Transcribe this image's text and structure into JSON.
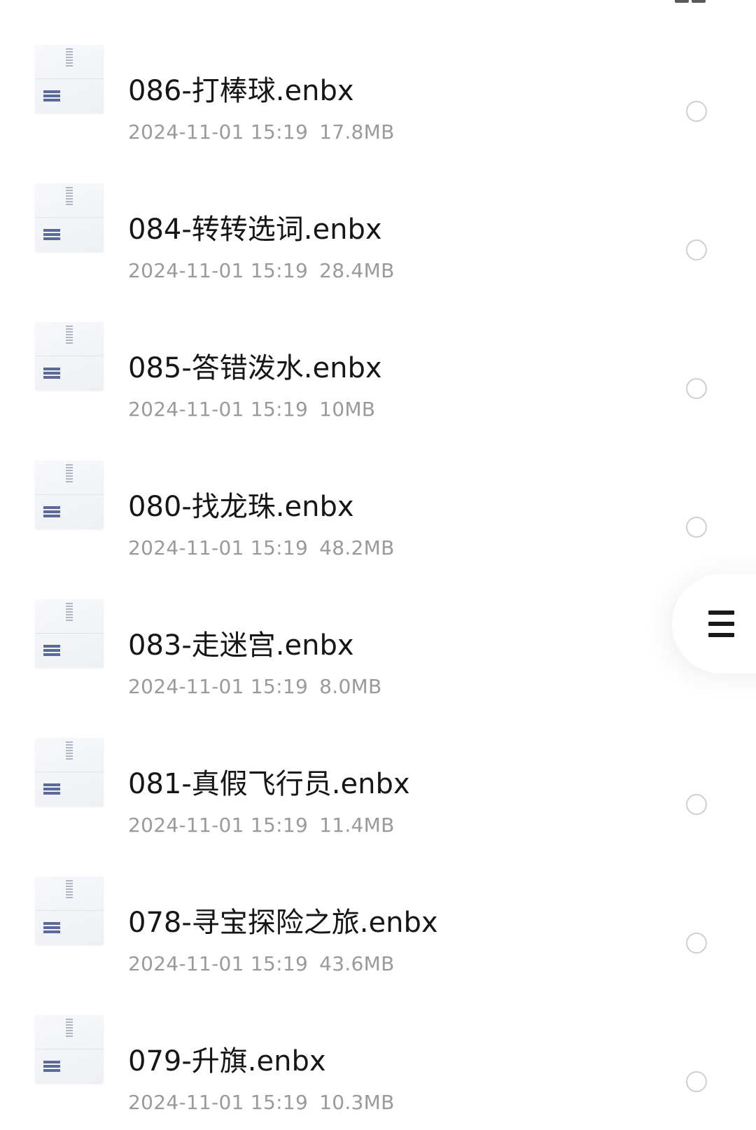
{
  "header": {
    "view_toggle_icon": "grid-view-icon"
  },
  "files": [
    {
      "name": "086-打棒球.enbx",
      "date": "2024-11-01 15:19",
      "size": "17.8MB"
    },
    {
      "name": "084-转转选词.enbx",
      "date": "2024-11-01 15:19",
      "size": "28.4MB"
    },
    {
      "name": "085-答错泼水.enbx",
      "date": "2024-11-01 15:19",
      "size": "10MB"
    },
    {
      "name": "080-找龙珠.enbx",
      "date": "2024-11-01 15:19",
      "size": "48.2MB"
    },
    {
      "name": "083-走迷宫.enbx",
      "date": "2024-11-01 15:19",
      "size": "8.0MB"
    },
    {
      "name": "081-真假飞行员.enbx",
      "date": "2024-11-01 15:19",
      "size": "11.4MB"
    },
    {
      "name": "078-寻宝探险之旅.enbx",
      "date": "2024-11-01 15:19",
      "size": "43.6MB"
    },
    {
      "name": "079-升旗.enbx",
      "date": "2024-11-01 15:19",
      "size": "10.3MB"
    }
  ],
  "file_icon": "zip-archive-icon",
  "selection_icon": "radio-unchecked-icon",
  "floating_menu": {
    "icon": "hamburger-menu-icon"
  },
  "colors": {
    "title": "#161616",
    "meta": "#9a9a9a",
    "radio_border": "#cfcfcf",
    "thumb_bars": "#5b6a9a"
  }
}
